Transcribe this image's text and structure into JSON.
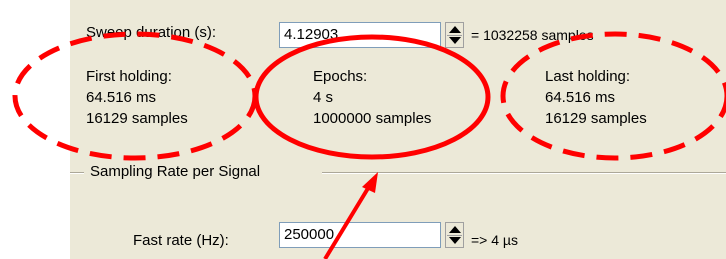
{
  "sweep": {
    "label": "Sweep duration (s):",
    "value": "4.12903",
    "samples": "= 1032258 samples"
  },
  "first_holding": {
    "title": "First holding:",
    "time": "64.516 ms",
    "samples": "16129 samples"
  },
  "epochs": {
    "title": "Epochs:",
    "time": "4 s",
    "samples": "1000000 samples"
  },
  "last_holding": {
    "title": "Last holding:",
    "time": "64.516 ms",
    "samples": "16129 samples"
  },
  "sampling": {
    "group_title": "Sampling Rate per Signal",
    "fast_rate_label": "Fast rate  (Hz):",
    "fast_rate_value": "250000",
    "fast_rate_result": "=> 4 µs"
  },
  "colors": {
    "panel": "#ece9d8",
    "annotation": "#ff0000"
  }
}
